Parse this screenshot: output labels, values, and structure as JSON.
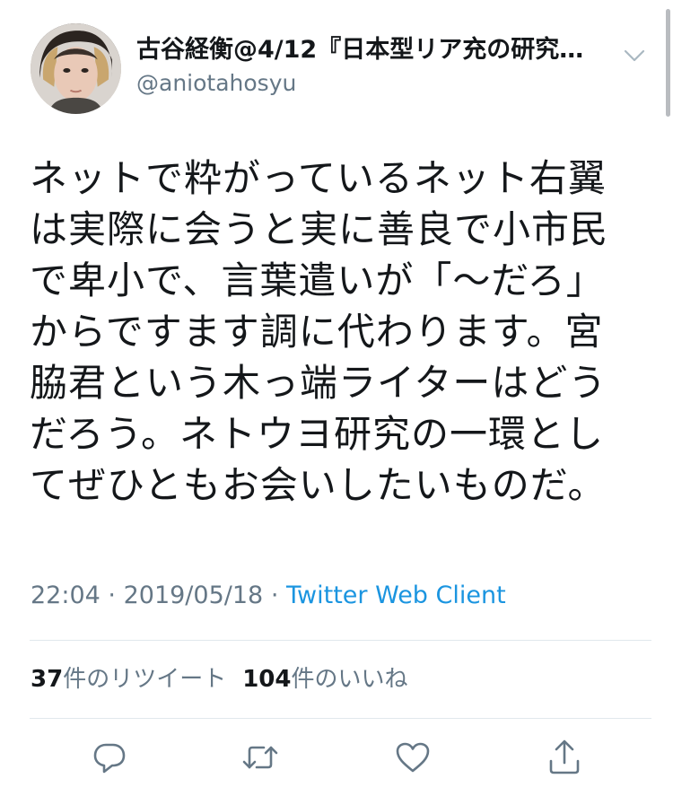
{
  "tweet": {
    "author": {
      "display_name": "古谷経衡@4/12『日本型リア充の研究…",
      "handle": "@aniotahosyu",
      "avatar_icon": "user-avatar"
    },
    "menu_icon": "chevron-down-icon",
    "text_lines": [
      "ネットで粋がっているネット右翼",
      "は実際に会うと実に善良で小市民",
      "で卑小で、言葉遣いが「〜だろ」",
      "からですます調に代わります。宮",
      "脇君という木っ端ライターはどう",
      "だろう。ネトウヨ研究の一環とし",
      "てぜひともお会いしたいものだ。"
    ],
    "time": "22:04",
    "separator": "·",
    "date": "2019/05/18",
    "client": "Twitter Web Client",
    "retweet_count": "37",
    "retweet_label": "件のリツイート",
    "like_count": "104",
    "like_label": "件のいいね",
    "actions": {
      "reply_icon": "reply-icon",
      "retweet_icon": "retweet-icon",
      "like_icon": "heart-icon",
      "share_icon": "share-icon"
    }
  },
  "colors": {
    "text_primary": "#14171a",
    "text_secondary": "#657786",
    "link": "#1b95e0",
    "divider": "#e1e8ed",
    "icon": "#657786"
  }
}
